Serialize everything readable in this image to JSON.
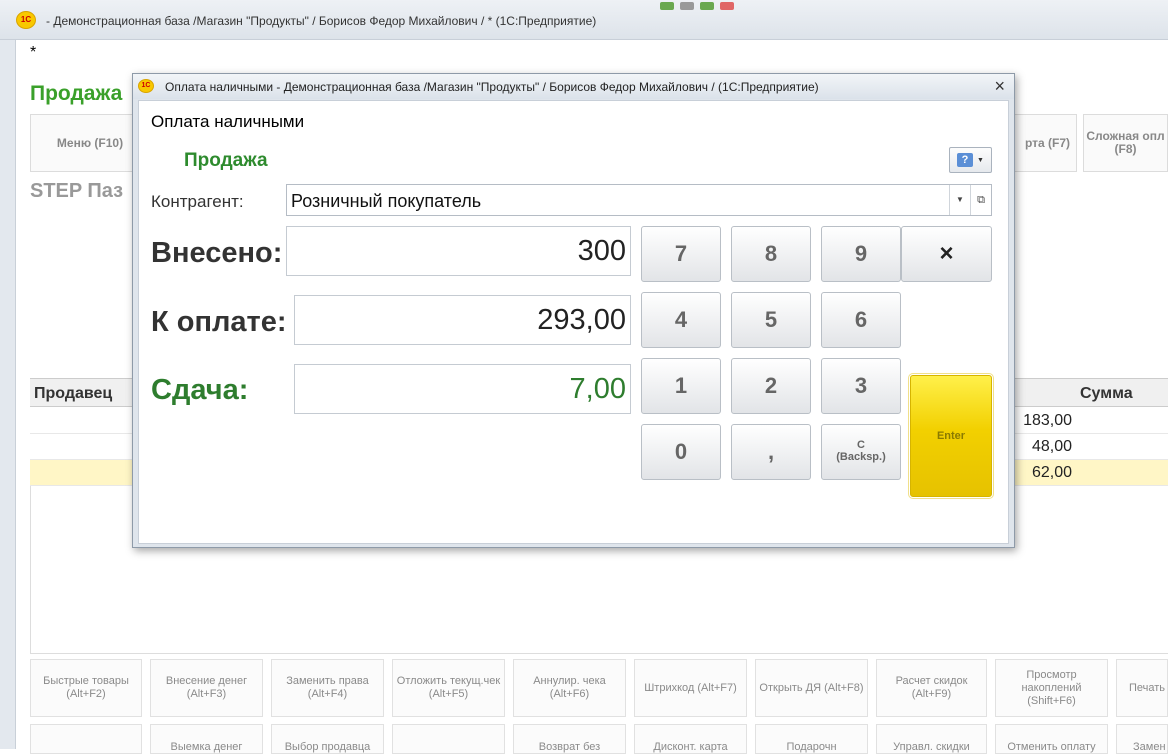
{
  "main_window": {
    "title": "- Демонстрационная база /Магазин \"Продукты\" / Борисов Федор Михайлович / * (1С:Предприятие)",
    "asterisk": "*",
    "heading": "Продажа",
    "store_label": "STEP Паз",
    "top_buttons": [
      {
        "label": "Меню (F10)"
      },
      {
        "label": "рта (F7)"
      },
      {
        "label": "Сложная опл (F8)"
      }
    ],
    "grid": {
      "col_seller": "Продавец",
      "col_sum": "Сумма",
      "rows": [
        {
          "sum": "183,00"
        },
        {
          "sum": "48,00"
        },
        {
          "sum": "62,00"
        }
      ]
    },
    "bottom_buttons": [
      "Быстрые товары (Alt+F2)",
      "Внесение денег (Alt+F3)",
      "Заменить права (Alt+F4)",
      "Отложить текущ.чек (Alt+F5)",
      "Аннулир. чека (Alt+F6)",
      "Штрихкод (Alt+F7)",
      "Открыть ДЯ (Alt+F8)",
      "Расчет скидок (Alt+F9)",
      "Просмотр накоплений (Shift+F6)",
      "Печать"
    ],
    "bottom_buttons_row2": [
      "",
      "Выемка денег",
      "Выбор продавца",
      "",
      "Возврат без",
      "Дисконт. карта",
      "Подарочн",
      "Управл. скидки",
      "Отменить оплату",
      "Замен"
    ]
  },
  "dialog": {
    "title": "Оплата наличными - Демонстрационная база /Магазин \"Продукты\" / Борисов Федор Михайлович /  (1С:Предприятие)",
    "close_glyph": "×",
    "form_title": "Оплата наличными",
    "heading": "Продажа",
    "counterparty_label": "Контрагент:",
    "counterparty_value": "Розничный покупатель",
    "paid_label": "Внесено:",
    "paid_value": "300",
    "due_label": "К оплате:",
    "due_value": "293,00",
    "change_label": "Сдача:",
    "change_value": "7,00",
    "keys": {
      "k7": "7",
      "k8": "8",
      "k9": "9",
      "clear": "×",
      "k4": "4",
      "k5": "5",
      "k6": "6",
      "k1": "1",
      "k2": "2",
      "k3": "3",
      "k0": "0",
      "comma": ",",
      "backspace_c": "C",
      "backspace_hint": "(Backsp.)",
      "enter": "Enter"
    }
  },
  "colors": {
    "green_heading": "#2e8b2e",
    "enter_yellow": "#f2d000",
    "selected_row": "#fff6c6"
  },
  "icons": {
    "app_logo": "1c-logo-icon",
    "help": "help-icon"
  }
}
